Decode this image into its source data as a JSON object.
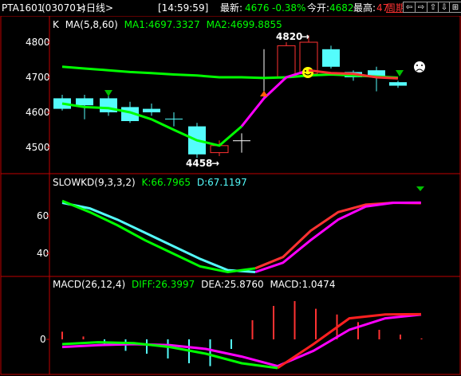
{
  "header": {
    "symbol": "PTA1601",
    "code": "(030701)",
    "period": "<日线>",
    "time": "[14:59:59]",
    "latest_label": "最新:",
    "latest_value": "4676",
    "change": "-0.38%",
    "open_label": "今开:",
    "open_value": "4682",
    "high_label": "最高:",
    "high_value": "47",
    "cycle_label": "周期",
    "buttons": [
      "⇦",
      "⇨",
      "⇧",
      "⇩",
      "⊞"
    ]
  },
  "colors": {
    "up": "#ff3232",
    "down": "#54fcfc",
    "ma1": "#ffffff",
    "ma2": "#00ff00",
    "magenta": "#ff00ff",
    "grid": "#c00000"
  },
  "main": {
    "title_k": "K",
    "title_ma": "MA(5,8,60)",
    "ma1_label": "MA1:4697.3327",
    "ma2_label": "MA2:4699.8855",
    "y_ticks": [
      "4800",
      "4700",
      "4600",
      "4500"
    ],
    "high_marker": "4820",
    "low_marker": "4458"
  },
  "slowkd": {
    "title": "SLOWKD(9,3,3,2)",
    "k_label": "K:66.7965",
    "d_label": "D:67.1197",
    "y_ticks": [
      "60",
      "40"
    ]
  },
  "macd": {
    "title": "MACD(26,12,4)",
    "diff_label": "DIFF:26.3997",
    "dea_label": "DEA:25.8760",
    "macd_label": "MACD:1.0474",
    "y_ticks": [
      "0"
    ]
  },
  "chart_data": {
    "type": "candlestick",
    "y_range": [
      4420,
      4860
    ],
    "candles": [
      {
        "o": 4640,
        "c": 4610,
        "h": 4650,
        "l": 4605
      },
      {
        "o": 4640,
        "c": 4620,
        "h": 4650,
        "l": 4580
      },
      {
        "o": 4640,
        "c": 4600,
        "h": 4650,
        "l": 4590
      },
      {
        "o": 4615,
        "c": 4575,
        "h": 4630,
        "l": 4570
      },
      {
        "o": 4610,
        "c": 4600,
        "h": 4625,
        "l": 4590
      },
      {
        "o": 4582,
        "c": 4580,
        "h": 4600,
        "l": 4560
      },
      {
        "o": 4560,
        "c": 4480,
        "h": 4570,
        "l": 4470
      },
      {
        "o": 4485,
        "c": 4505,
        "h": 4520,
        "l": 4475
      },
      {
        "o": 4520,
        "c": 4520,
        "h": 4540,
        "l": 4485
      },
      {
        "o": 4700,
        "c": 4700,
        "h": 4780,
        "l": 4640
      },
      {
        "o": 4700,
        "c": 4790,
        "h": 4800,
        "l": 4695
      },
      {
        "o": 4710,
        "c": 4800,
        "h": 4820,
        "l": 4700
      },
      {
        "o": 4780,
        "c": 4730,
        "h": 4790,
        "l": 4725
      },
      {
        "o": 4715,
        "c": 4700,
        "h": 4720,
        "l": 4690
      },
      {
        "o": 4720,
        "c": 4700,
        "h": 4730,
        "l": 4660
      },
      {
        "o": 4686,
        "c": 4676,
        "h": 4690,
        "l": 4670
      }
    ],
    "ma1": [
      4625,
      4615,
      4612,
      4600,
      4580,
      4550,
      4520,
      4505,
      4560,
      4640,
      4700,
      4720,
      4712,
      4710,
      4700,
      4697
    ],
    "ma2": [
      4730,
      4725,
      4720,
      4715,
      4712,
      4708,
      4705,
      4700,
      4700,
      4698,
      4700,
      4705,
      4708,
      4705,
      4702,
      4699
    ],
    "k": [
      68,
      62,
      55,
      47,
      40,
      33,
      30,
      32,
      38,
      52,
      62,
      66,
      67,
      66.8
    ],
    "d": [
      67,
      64,
      58,
      51,
      44,
      37,
      31,
      30,
      35,
      47,
      58,
      65,
      67,
      67.1
    ],
    "macd_bars": [
      8,
      3,
      -5,
      -12,
      -15,
      -20,
      -25,
      -28,
      -10,
      20,
      35,
      40,
      32,
      26,
      18,
      10,
      5,
      1
    ],
    "diff": [
      -5,
      -3,
      -4,
      -8,
      -15,
      -25,
      -30,
      -5,
      22,
      26,
      26.4
    ],
    "dea": [
      -8,
      -6,
      -5,
      -6,
      -10,
      -18,
      -28,
      -12,
      10,
      22,
      25.9
    ]
  }
}
